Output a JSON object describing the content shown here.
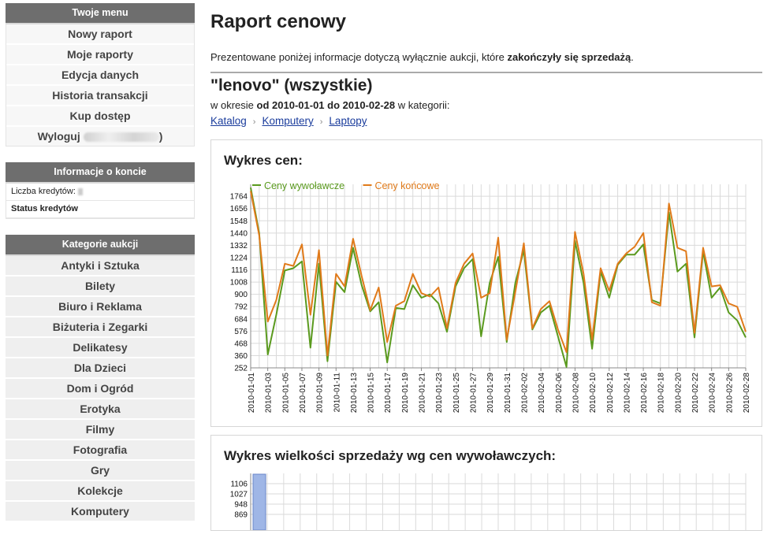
{
  "sidebar": {
    "menu_title": "Twoje menu",
    "menu_items": [
      "Nowy raport",
      "Moje raporty",
      "Edycja danych",
      "Historia transakcji",
      "Kup dostęp",
      "Wyloguj"
    ],
    "logout_suffix": ")",
    "account_title": "Informacje o koncie",
    "account_rows": [
      "Liczba kredytów:",
      "Status kredytów"
    ],
    "categories_title": "Kategorie aukcji",
    "categories": [
      "Antyki i Sztuka",
      "Bilety",
      "Biuro i Reklama",
      "Biżuteria i Zegarki",
      "Delikatesy",
      "Dla Dzieci",
      "Dom i Ogród",
      "Erotyka",
      "Filmy",
      "Fotografia",
      "Gry",
      "Kolekcje",
      "Komputery"
    ]
  },
  "main": {
    "title": "Raport cenowy",
    "intro_text": "Prezentowane poniżej informacje dotyczą wyłącznie aukcji, które ",
    "intro_bold": "zakończyły się sprzedażą",
    "intro_end": ".",
    "query": "\"lenovo\" (wszystkie)",
    "period_pre": "w okresie ",
    "period_bold": "od 2010-01-01 do 2010-02-28",
    "period_post": " w kategorii:",
    "breadcrumbs": [
      "Katalog",
      "Komputery",
      "Laptopy"
    ],
    "breadcrumb_sep": "›"
  },
  "chart1_title": "Wykres cen:",
  "chart2_title": "Wykres wielkości sprzedaży wg cen wywoławczych:",
  "chart_data": [
    {
      "type": "line",
      "title": "Wykres cen:",
      "xlabel": "",
      "ylabel": "",
      "ylim": [
        252,
        1800
      ],
      "yticks": [
        252,
        360,
        468,
        576,
        684,
        792,
        900,
        1008,
        1116,
        1224,
        1332,
        1440,
        1548,
        1656,
        1764
      ],
      "xtick_labels": [
        "2010-01-01",
        "2010-01-03",
        "2010-01-05",
        "2010-01-07",
        "2010-01-09",
        "2010-01-11",
        "2010-01-13",
        "2010-01-15",
        "2010-01-17",
        "2010-01-19",
        "2010-01-21",
        "2010-01-23",
        "2010-01-25",
        "2010-01-27",
        "2010-01-29",
        "2010-01-31",
        "2010-02-02",
        "2010-02-04",
        "2010-02-06",
        "2010-02-08",
        "2010-02-10",
        "2010-02-12",
        "2010-02-14",
        "2010-02-16",
        "2010-02-18",
        "2010-02-20",
        "2010-02-22",
        "2010-02-24",
        "2010-02-26",
        "2010-02-28"
      ],
      "grid": true,
      "legend_position": "top-left",
      "series": [
        {
          "name": "Ceny wywoławcze",
          "color": "#5a9a1e",
          "values": [
            1840,
            1440,
            370,
            720,
            1110,
            1130,
            1190,
            430,
            1170,
            310,
            1010,
            920,
            1310,
            980,
            750,
            830,
            300,
            780,
            770,
            980,
            870,
            900,
            820,
            570,
            970,
            1130,
            1210,
            530,
            1000,
            1230,
            480,
            1000,
            1290,
            590,
            740,
            800,
            530,
            260,
            1370,
            1000,
            420,
            1100,
            870,
            1160,
            1250,
            1250,
            1340,
            850,
            820,
            1620,
            1100,
            1170,
            520,
            1280,
            870,
            960,
            740,
            670,
            520
          ]
        },
        {
          "name": "Ceny końcowe",
          "color": "#e07a1a",
          "values": [
            1810,
            1420,
            660,
            850,
            1170,
            1150,
            1340,
            720,
            1290,
            360,
            1080,
            970,
            1390,
            1060,
            760,
            960,
            480,
            800,
            840,
            1080,
            910,
            880,
            960,
            600,
            1000,
            1170,
            1260,
            870,
            910,
            1400,
            500,
            920,
            1350,
            600,
            770,
            840,
            590,
            390,
            1450,
            1080,
            500,
            1130,
            930,
            1170,
            1260,
            1320,
            1440,
            830,
            800,
            1700,
            1310,
            1280,
            560,
            1310,
            970,
            980,
            820,
            790,
            570
          ]
        }
      ]
    },
    {
      "type": "bar",
      "title": "Wykres wielkości sprzedaży wg cen wywoławczych:",
      "xlabel": "",
      "ylabel": "",
      "yticks": [
        869,
        948,
        1027,
        1106
      ],
      "grid": true
    }
  ]
}
